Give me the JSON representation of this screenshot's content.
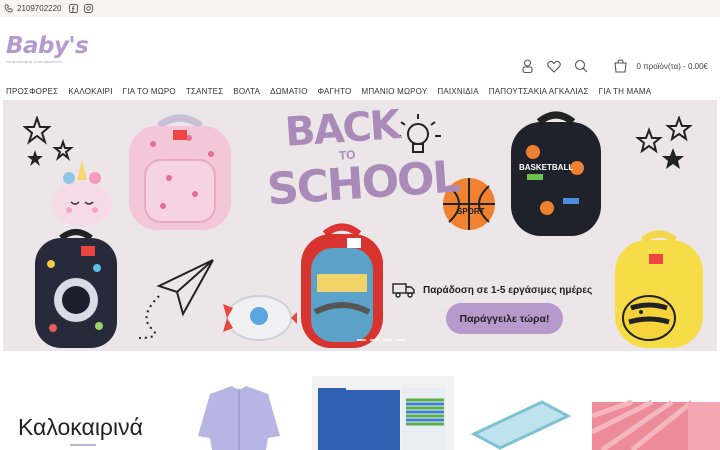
{
  "topbar": {
    "phone": "2109702220",
    "icons": [
      "phone-icon",
      "facebook-icon",
      "instagram-icon"
    ]
  },
  "header": {
    "logo": {
      "word": "Baby's",
      "tagline": "YOUR FAVORITE CLUB PRODUCTS"
    },
    "cart_text": "0 προϊόν(τα) - 0.00€",
    "icons": [
      "user-icon",
      "heart-icon",
      "search-icon",
      "cart-icon"
    ]
  },
  "nav": {
    "items": [
      {
        "label": "ΠΡΟΣΦΟΡΕΣ"
      },
      {
        "label": "ΚΑΛΟΚΑΙΡΙ"
      },
      {
        "label": "ΓΙΑ ΤΟ ΜΩΡΟ"
      },
      {
        "label": "ΤΣΑΝΤΕΣ"
      },
      {
        "label": "ΒΟΛΤΑ"
      },
      {
        "label": "ΔΩΜΑΤΙΟ"
      },
      {
        "label": "ΦΑΓΗΤΟ"
      },
      {
        "label": "ΜΠΑΝΙΟ ΜΩΡΟΥ"
      },
      {
        "label": "ΠΑΙΧΝΙΔΙΑ"
      },
      {
        "label": "ΠΑΠΟΥΤΣΑΚΙΑ ΑΓΚΑΛΙΑΣ"
      },
      {
        "label": "ΓΙΑ ΤΗ ΜΑΜΑ"
      }
    ]
  },
  "banner": {
    "headline_1": "BACK",
    "headline_2": "TO",
    "headline_3": "SCHOOL",
    "delivery_text": "Παράδοση σε 1-5 εργάσιμες ημέρες",
    "cta": "Παράγγειλε τώρα!",
    "bag_labels": {
      "ball": "SPORT",
      "bag": "BASKETBALL"
    }
  },
  "section": {
    "title": "Καλοκαιρινά"
  },
  "colors": {
    "accent": "#b69acb",
    "banner_bg": "#ece6e8",
    "topbar_bg": "#f7f4f2"
  }
}
